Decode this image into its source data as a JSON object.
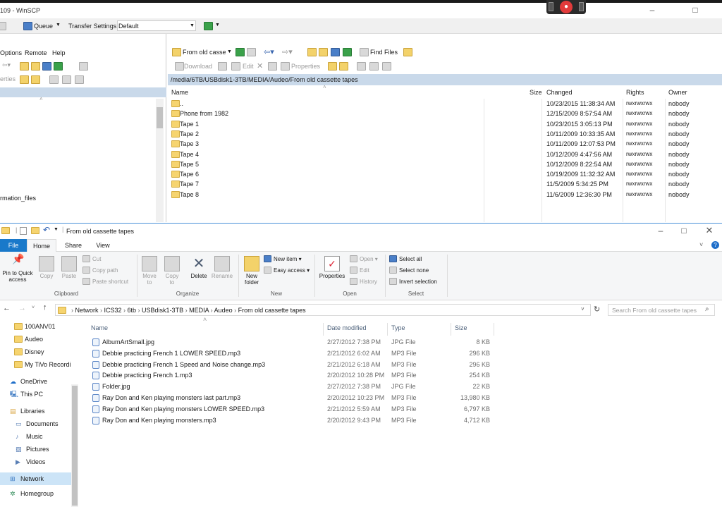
{
  "winscp": {
    "title": "109 - WinSCP",
    "toolbar": {
      "queue": "Queue",
      "transfer_settings_label": "Transfer Settings",
      "transfer_settings_value": "Default"
    },
    "left_menu": [
      "Options",
      "Remote",
      "Help"
    ],
    "left_props": "erties",
    "left_file": "rmation_files",
    "right_toolbar": {
      "location": "From old casse",
      "find_files": "Find Files",
      "download": "Download",
      "edit": "Edit",
      "properties": "Properties"
    },
    "remote_path": "/media/6TB/USBdisk1-3TB/MEDIA/Audeo/From old cassette tapes",
    "columns": {
      "name": "Name",
      "size": "Size",
      "changed": "Changed",
      "rights": "Rights",
      "owner": "Owner"
    },
    "rows": [
      {
        "name": "..",
        "changed": "10/23/2015 11:38:34 AM",
        "rights": "rwxrwxrwx",
        "owner": "nobody"
      },
      {
        "name": "Phone from 1982",
        "changed": "12/15/2009 8:57:54 AM",
        "rights": "rwxrwxrwx",
        "owner": "nobody"
      },
      {
        "name": "Tape 1",
        "changed": "10/23/2015 3:05:13 PM",
        "rights": "rwxrwxrwx",
        "owner": "nobody"
      },
      {
        "name": "Tape 2",
        "changed": "10/11/2009 10:33:35 AM",
        "rights": "rwxrwxrwx",
        "owner": "nobody"
      },
      {
        "name": "Tape 3",
        "changed": "10/11/2009 12:07:53 PM",
        "rights": "rwxrwxrwx",
        "owner": "nobody"
      },
      {
        "name": "Tape 4",
        "changed": "10/12/2009 4:47:56 AM",
        "rights": "rwxrwxrwx",
        "owner": "nobody"
      },
      {
        "name": "Tape 5",
        "changed": "10/12/2009 8:22:54 AM",
        "rights": "rwxrwxrwx",
        "owner": "nobody"
      },
      {
        "name": "Tape 6",
        "changed": "10/19/2009 11:32:32 AM",
        "rights": "rwxrwxrwx",
        "owner": "nobody"
      },
      {
        "name": "Tape 7",
        "changed": "11/5/2009 5:34:25 PM",
        "rights": "rwxrwxrwx",
        "owner": "nobody"
      },
      {
        "name": "Tape 8",
        "changed": "11/6/2009 12:36:30 PM",
        "rights": "rwxrwxrwx",
        "owner": "nobody"
      }
    ]
  },
  "explorer": {
    "title": "From old cassette tapes",
    "tabs": {
      "file": "File",
      "home": "Home",
      "share": "Share",
      "view": "View"
    },
    "ribbon": {
      "pin": "Pin to Quick\naccess",
      "copy": "Copy",
      "paste": "Paste",
      "cut": "Cut",
      "copy_path": "Copy path",
      "paste_shortcut": "Paste shortcut",
      "move_to": "Move\nto",
      "copy_to": "Copy\nto",
      "delete": "Delete",
      "rename": "Rename",
      "new_folder": "New\nfolder",
      "new_item": "New item",
      "easy_access": "Easy access",
      "properties": "Properties",
      "open": "Open",
      "edit": "Edit",
      "history": "History",
      "select_all": "Select all",
      "select_none": "Select none",
      "invert_selection": "Invert selection",
      "groups": {
        "clipboard": "Clipboard",
        "organize": "Organize",
        "new": "New",
        "open": "Open",
        "select": "Select"
      }
    },
    "breadcrumb": [
      "Network",
      "ICS32",
      "6tb",
      "USBdisk1-3TB",
      "MEDIA",
      "Audeo",
      "From old cassette tapes"
    ],
    "search_placeholder": "Search From old cassette tapes",
    "nav": {
      "folders": [
        "100ANV01",
        "Audeo",
        "Disney",
        "My TiVo Recordi"
      ],
      "onedrive": "OneDrive",
      "thispc": "This PC",
      "libraries": "Libraries",
      "libs": [
        "Documents",
        "Music",
        "Pictures",
        "Videos"
      ],
      "network": "Network",
      "homegroup": "Homegroup"
    },
    "columns": {
      "name": "Name",
      "date": "Date modified",
      "type": "Type",
      "size": "Size"
    },
    "files": [
      {
        "name": "AlbumArtSmall.jpg",
        "date": "2/27/2012 7:38 PM",
        "type": "JPG File",
        "size": "8 KB"
      },
      {
        "name": "Debbie practicing French 1 LOWER SPEED.mp3",
        "date": "2/21/2012 6:02 AM",
        "type": "MP3 File",
        "size": "296 KB"
      },
      {
        "name": "Debbie practicing French 1 Speed and Noise change.mp3",
        "date": "2/21/2012 6:18 AM",
        "type": "MP3 File",
        "size": "296 KB"
      },
      {
        "name": "Debbie practicing French 1.mp3",
        "date": "2/20/2012 10:28 PM",
        "type": "MP3 File",
        "size": "254 KB"
      },
      {
        "name": "Folder.jpg",
        "date": "2/27/2012 7:38 PM",
        "type": "JPG File",
        "size": "22 KB"
      },
      {
        "name": "Ray Don and Ken playing monsters last part.mp3",
        "date": "2/20/2012 10:23 PM",
        "type": "MP3 File",
        "size": "13,980 KB"
      },
      {
        "name": "Ray Don and Ken playing monsters LOWER SPEED.mp3",
        "date": "2/21/2012 5:59 AM",
        "type": "MP3 File",
        "size": "6,797 KB"
      },
      {
        "name": "Ray Don and Ken playing monsters.mp3",
        "date": "2/20/2012 9:43 PM",
        "type": "MP3 File",
        "size": "4,712 KB"
      }
    ]
  }
}
